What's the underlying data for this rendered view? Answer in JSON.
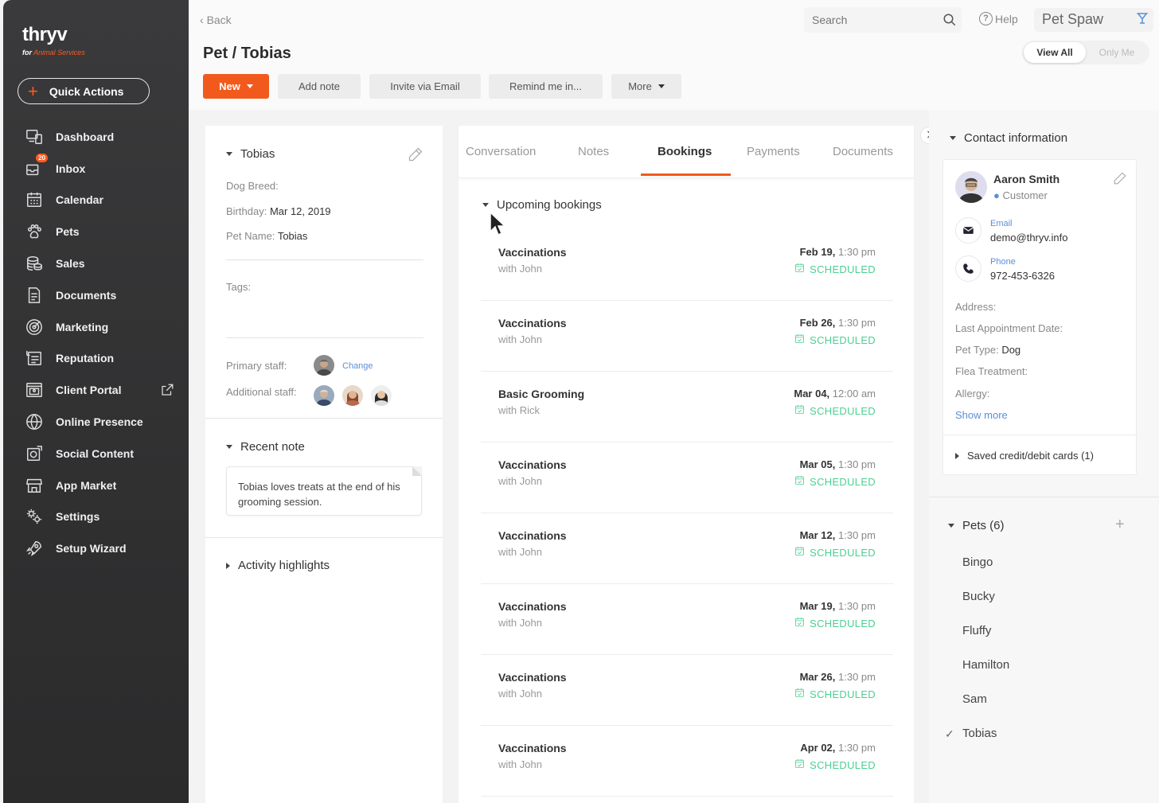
{
  "brand": {
    "logo_text": "thryv",
    "logo_sub_prefix": "for",
    "logo_sub": "Animal Services",
    "accent": "#f25a1d"
  },
  "quick_actions": {
    "label": "Quick Actions"
  },
  "nav": {
    "items": [
      {
        "label": "Dashboard",
        "icon": "dashboard-icon"
      },
      {
        "label": "Inbox",
        "icon": "inbox-icon",
        "badge": "20"
      },
      {
        "label": "Calendar",
        "icon": "calendar-icon"
      },
      {
        "label": "Pets",
        "icon": "paw-icon"
      },
      {
        "label": "Sales",
        "icon": "coins-icon"
      },
      {
        "label": "Documents",
        "icon": "document-icon"
      },
      {
        "label": "Marketing",
        "icon": "target-icon"
      },
      {
        "label": "Reputation",
        "icon": "reputation-icon"
      },
      {
        "label": "Client Portal",
        "icon": "portal-icon"
      },
      {
        "label": "Online Presence",
        "icon": "globe-icon"
      },
      {
        "label": "Social Content",
        "icon": "social-icon"
      },
      {
        "label": "App Market",
        "icon": "store-icon"
      },
      {
        "label": "Settings",
        "icon": "gear-icon"
      },
      {
        "label": "Setup Wizard",
        "icon": "rocket-icon"
      }
    ]
  },
  "topbar": {
    "back_label": "Back",
    "search_placeholder": "Search",
    "help_label": "Help",
    "company": "Pet Spaw"
  },
  "header": {
    "title": "Pet / Tobias",
    "buttons": {
      "new": "New",
      "add_note": "Add note",
      "invite": "Invite via Email",
      "remind": "Remind me in...",
      "more": "More"
    },
    "toggle": {
      "view_all": "View All",
      "only_me": "Only Me"
    }
  },
  "pet": {
    "name": "Tobias",
    "fields": {
      "breed_label": "Dog Breed:",
      "breed_value": "",
      "birthday_label": "Birthday:",
      "birthday_value": "Mar 12, 2019",
      "petname_label": "Pet Name:",
      "petname_value": "Tobias"
    },
    "tags_label": "Tags:",
    "primary_staff_label": "Primary staff:",
    "change_label": "Change",
    "additional_staff_label": "Additional staff:",
    "recent_note_title": "Recent note",
    "recent_note_text": "Tobias loves treats at the end of his grooming session.",
    "activity_title": "Activity highlights"
  },
  "tabs": {
    "conversation": "Conversation",
    "notes": "Notes",
    "bookings": "Bookings",
    "payments": "Payments",
    "documents": "Documents"
  },
  "bookings": {
    "section_title": "Upcoming bookings",
    "items": [
      {
        "service": "Vaccinations",
        "staff": "with John",
        "date": "Feb 19,",
        "time": "1:30 pm",
        "status": "SCHEDULED"
      },
      {
        "service": "Vaccinations",
        "staff": "with John",
        "date": "Feb 26,",
        "time": "1:30 pm",
        "status": "SCHEDULED"
      },
      {
        "service": "Basic Grooming",
        "staff": "with Rick",
        "date": "Mar 04,",
        "time": "12:00 am",
        "status": "SCHEDULED"
      },
      {
        "service": "Vaccinations",
        "staff": "with John",
        "date": "Mar 05,",
        "time": "1:30 pm",
        "status": "SCHEDULED"
      },
      {
        "service": "Vaccinations",
        "staff": "with John",
        "date": "Mar 12,",
        "time": "1:30 pm",
        "status": "SCHEDULED"
      },
      {
        "service": "Vaccinations",
        "staff": "with John",
        "date": "Mar 19,",
        "time": "1:30 pm",
        "status": "SCHEDULED"
      },
      {
        "service": "Vaccinations",
        "staff": "with John",
        "date": "Mar 26,",
        "time": "1:30 pm",
        "status": "SCHEDULED"
      },
      {
        "service": "Vaccinations",
        "staff": "with John",
        "date": "Apr 02,",
        "time": "1:30 pm",
        "status": "SCHEDULED"
      }
    ]
  },
  "contact": {
    "section_title": "Contact information",
    "name": "Aaron Smith",
    "role": "Customer",
    "email_label": "Email",
    "email": "demo@thryv.info",
    "phone_label": "Phone",
    "phone": "972-453-6326",
    "address_label": "Address:",
    "last_appt_label": "Last Appointment Date:",
    "pet_type_label": "Pet Type:",
    "pet_type_value": "Dog",
    "flea_label": "Flea Treatment:",
    "allergy_label": "Allergy:",
    "show_more": "Show more",
    "saved_cards": "Saved credit/debit cards (1)"
  },
  "pets_list": {
    "title": "Pets (6)",
    "items": [
      "Bingo",
      "Bucky",
      "Fluffy",
      "Hamilton",
      "Sam",
      "Tobias"
    ],
    "selected": "Tobias"
  }
}
